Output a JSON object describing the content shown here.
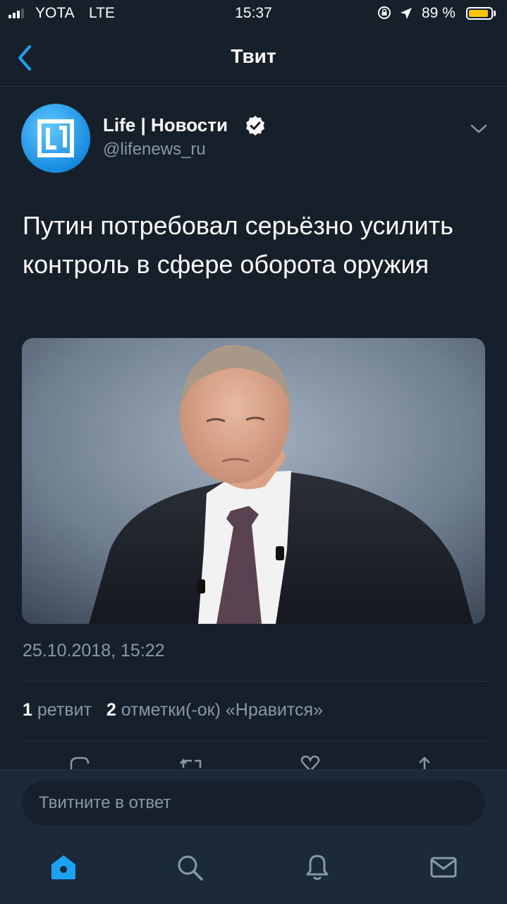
{
  "status_bar": {
    "carrier": "YOTA",
    "network": "LTE",
    "time": "15:37",
    "battery_percent": "89 %",
    "battery_level": 0.89,
    "battery_color": "#f7c600",
    "signal_icon": "signal-bars-icon",
    "lock_icon": "rotation-lock-icon",
    "location_icon": "location-arrow-icon"
  },
  "nav": {
    "back_icon": "chevron-left-icon",
    "title": "Твит"
  },
  "tweet": {
    "author_name": "Life | Новости",
    "handle": "@lifenews_ru",
    "verified_icon": "verified-badge-icon",
    "menu_icon": "chevron-down-icon",
    "text": "Путин потребовал серьёзно усилить контроль в сфере оборота оружия",
    "media_alt": "photo",
    "timestamp": "25.10.2018, 15:22",
    "retweet_count": "1",
    "retweet_label": "ретвит",
    "like_count": "2",
    "like_label": "отметки(-ок) «Нравится»"
  },
  "actions": [
    "reply-icon",
    "retweet-icon",
    "like-icon",
    "share-icon"
  ],
  "compose": {
    "placeholder": "Твитните в ответ"
  },
  "tabbar": {
    "items": [
      "home-icon",
      "search-icon",
      "notifications-icon",
      "messages-icon"
    ],
    "accent_color": "#1da1f2"
  }
}
